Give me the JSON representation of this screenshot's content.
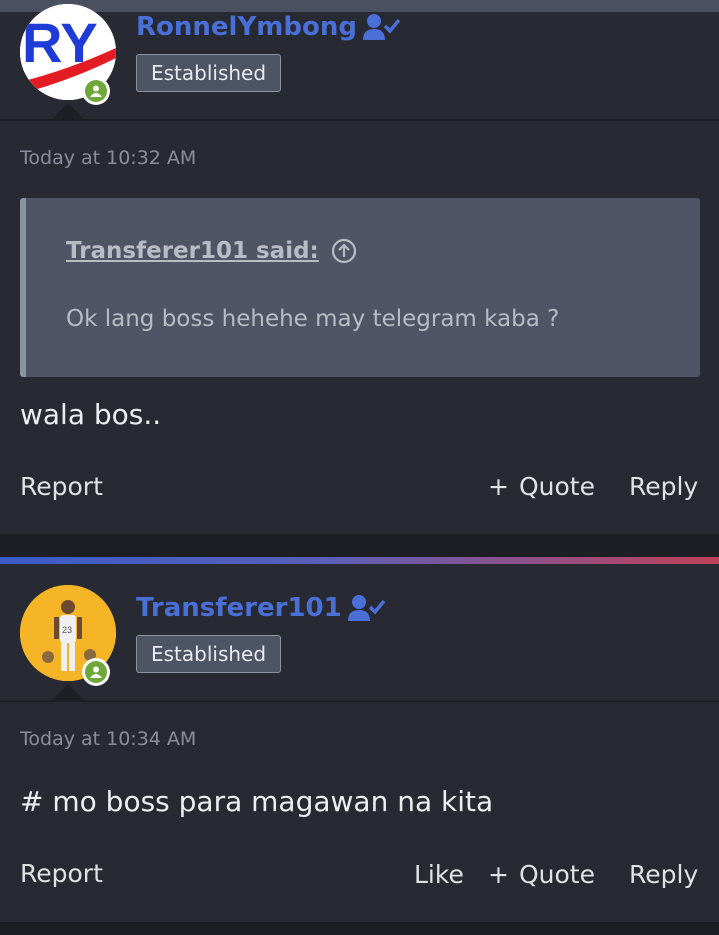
{
  "posts": [
    {
      "username": "RonnelYmbong",
      "user_badge_icon": "user-check-icon",
      "title_badge": "Established",
      "timestamp": "Today at 10:32 AM",
      "quote": {
        "author": "Transferer101 said:",
        "text": "Ok lang boss hehehe may telegram kaba ?"
      },
      "body": "wala bos..",
      "actions": {
        "report": "Report",
        "quote": "Quote",
        "reply": "Reply"
      }
    },
    {
      "username": "Transferer101",
      "user_badge_icon": "user-check-icon",
      "title_badge": "Established",
      "timestamp": "Today at 10:34 AM",
      "body": "# mo boss para magawan na kita",
      "actions": {
        "report": "Report",
        "like": "Like",
        "quote": "Quote",
        "reply": "Reply"
      }
    }
  ],
  "avatar1_text": "RY",
  "avatar2_text": "23",
  "colors": {
    "username": "#4a6fd6",
    "online": "#6fa83a",
    "post_bg": "#272a33",
    "quote_bg": "#4f5565"
  }
}
